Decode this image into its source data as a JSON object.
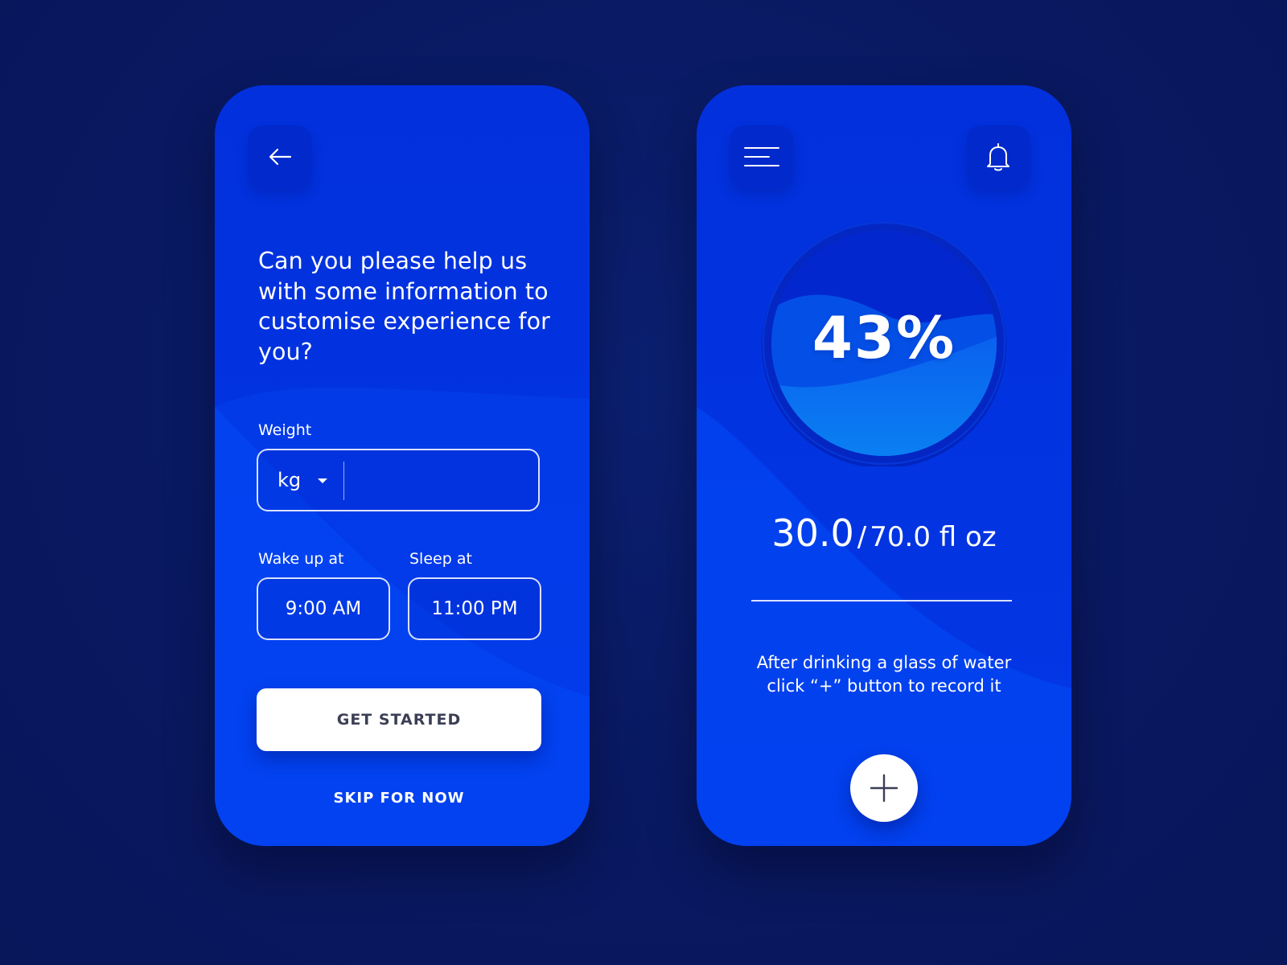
{
  "onboarding": {
    "back_icon": "arrow-left-icon",
    "question": "Can you please help us with some information to customise experience for you?",
    "weight": {
      "label": "Weight",
      "unit": "kg",
      "value": ""
    },
    "wake_up": {
      "label": "Wake up at",
      "value": "9:00 AM"
    },
    "sleep": {
      "label": "Sleep at",
      "value": "11:00 PM"
    },
    "get_started_label": "GET STARTED",
    "skip_label": "SKIP FOR NOW"
  },
  "tracker": {
    "menu_icon": "menu-icon",
    "notification_icon": "bell-icon",
    "progress_percent_label": "43%",
    "progress_fraction": 0.43,
    "current_amount": "30.0",
    "separator": "/",
    "goal_amount": "70.0 fl oz",
    "hint": "After drinking a glass of water click “+” button to record it",
    "add_icon": "plus-icon"
  },
  "colors": {
    "background": "#0a1a63",
    "phone_blue": "#0337e6",
    "water_light": "#0a78f0",
    "water_dark": "#0450e6",
    "button_white": "#ffffff",
    "button_text": "#3b3f55"
  }
}
